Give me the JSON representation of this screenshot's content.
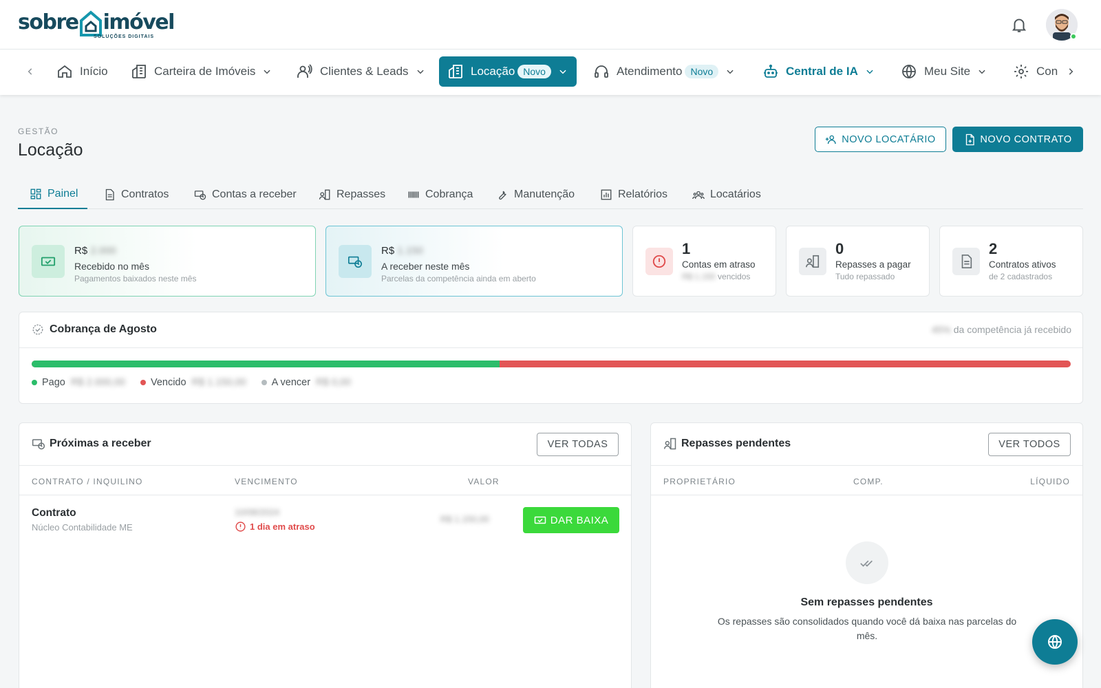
{
  "logo": {
    "word1": "sobre",
    "word2": "imóvel",
    "tagline": "SOLUÇÕES DIGITAIS"
  },
  "header": {
    "bell_icon": "bell-icon",
    "avatar": "user-avatar"
  },
  "nav": {
    "items": [
      {
        "label": "Início",
        "icon": "home-icon"
      },
      {
        "label": "Carteira de Imóveis",
        "icon": "building-icon"
      },
      {
        "label": "Clientes & Leads",
        "icon": "people-icon"
      },
      {
        "label": "Locação",
        "badge": "Novo",
        "icon": "building-key-icon"
      },
      {
        "label": "Atendimento",
        "badge": "Novo",
        "icon": "headset-icon"
      },
      {
        "label": "Central de IA",
        "icon": "robot-icon"
      },
      {
        "label": "Meu Site",
        "icon": "globe-icon"
      },
      {
        "label": "Con",
        "icon": "gear-icon"
      }
    ]
  },
  "page": {
    "eyebrow": "GESTÃO",
    "title": "Locação"
  },
  "actions": {
    "new_tenant": "NOVO LOCATÁRIO",
    "new_contract": "NOVO CONTRATO"
  },
  "tabs": [
    "Painel",
    "Contratos",
    "Contas a receber",
    "Repasses",
    "Cobrança",
    "Manutenção",
    "Relatórios",
    "Locatários"
  ],
  "kpis": {
    "received": {
      "currency": "R$",
      "value": "2.000",
      "label": "Recebido no mês",
      "sub": "Pagamentos baixados neste mês"
    },
    "to_receive": {
      "currency": "R$",
      "value": "1.150",
      "label": "A receber neste mês",
      "sub": "Parcelas da competência ainda em aberto"
    },
    "overdue": {
      "num": "1",
      "label": "Contas em atraso",
      "sub_hidden": "R$ 1.150",
      "sub": "vencidos"
    },
    "transfers": {
      "num": "0",
      "label": "Repasses a pagar",
      "sub": "Tudo repassado"
    },
    "contracts": {
      "num": "2",
      "label": "Contratos ativos",
      "sub": "de 2 cadastrados"
    }
  },
  "billing": {
    "title": "Cobrança de Agosto",
    "received_pct": "45%",
    "right_suffix": "da competência já recebido",
    "paid_fraction": 0.45,
    "legend": {
      "paid": "Pago",
      "paid_value": "R$ 2.000,00",
      "overdue": "Vencido",
      "overdue_value": "R$ 1.150,00",
      "upcoming": "A vencer",
      "upcoming_value": "R$ 0,00"
    },
    "colors": {
      "paid": "#2bbd6a",
      "overdue": "#e25555",
      "upcoming": "#b5bcbf"
    }
  },
  "receivables": {
    "title": "Próximas a receber",
    "button": "VER TODAS",
    "headers": [
      "CONTRATO / INQUILINO",
      "VENCIMENTO",
      "VALOR"
    ],
    "rows": [
      {
        "title": "Contrato",
        "tenant": "Núcleo Contabilidade ME",
        "date": "10/08/2024",
        "status": "1 dia em atraso",
        "value": "R$ 1.150,00",
        "action": "DAR BAIXA"
      }
    ]
  },
  "transfers_panel": {
    "title": "Repasses pendentes",
    "button": "VER TODOS",
    "headers": [
      "PROPRIETÁRIO",
      "COMP.",
      "LÍQUIDO"
    ],
    "empty_title": "Sem repasses pendentes",
    "empty_text": "Os repasses são consolidados quando você dá baixa nas parcelas do mês."
  },
  "fab": {
    "icon": "globe-icon"
  }
}
